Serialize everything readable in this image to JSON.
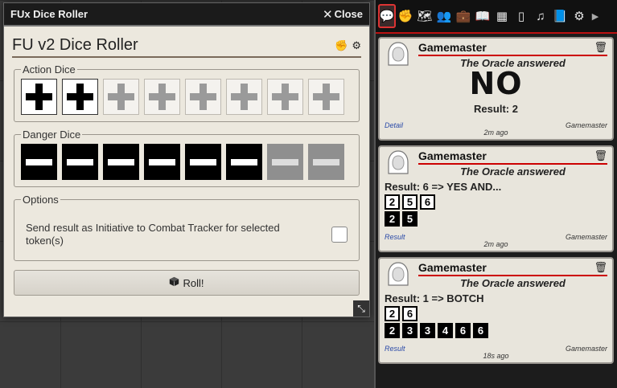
{
  "dialog": {
    "title": "FUx Dice Roller",
    "close_label": "Close",
    "roller_title": "FU v2 Dice Roller",
    "action_dice": {
      "legend": "Action Dice",
      "active_count": 2,
      "total": 8
    },
    "danger_dice": {
      "legend": "Danger Dice",
      "active_count": 6,
      "total": 8
    },
    "options": {
      "legend": "Options",
      "initiative_label": "Send result as Initiative to Combat Tracker for selected token(s)",
      "initiative_checked": false
    },
    "roll_label": "Roll!"
  },
  "sidebar": {
    "tabs": [
      "chat-icon",
      "fist-icon",
      "map-icon",
      "users-icon",
      "items-icon",
      "journal-icon",
      "tables-icon",
      "cards-icon",
      "music-icon",
      "compendium-icon",
      "settings-icon",
      "collapse-icon"
    ],
    "active_tab": 0
  },
  "chat": [
    {
      "speaker": "Gamemaster",
      "flavor": "The Oracle answered",
      "answer": "NO",
      "result": "Result: 2",
      "link": "Detail",
      "user": "Gamemaster",
      "time": "2m ago"
    },
    {
      "speaker": "Gamemaster",
      "flavor": "The Oracle answered",
      "result": "Result: 6 => YES AND...",
      "outline_dice": [
        "2",
        "5",
        "6"
      ],
      "solid_dice": [
        "2",
        "5"
      ],
      "link": "Result",
      "user": "Gamemaster",
      "time": "2m ago"
    },
    {
      "speaker": "Gamemaster",
      "flavor": "The Oracle answered",
      "result": "Result: 1 => BOTCH",
      "outline_dice": [
        "2",
        "6"
      ],
      "solid_dice": [
        "2",
        "3",
        "3",
        "4",
        "6",
        "6"
      ],
      "link": "Result",
      "user": "Gamemaster",
      "time": "18s ago"
    }
  ]
}
